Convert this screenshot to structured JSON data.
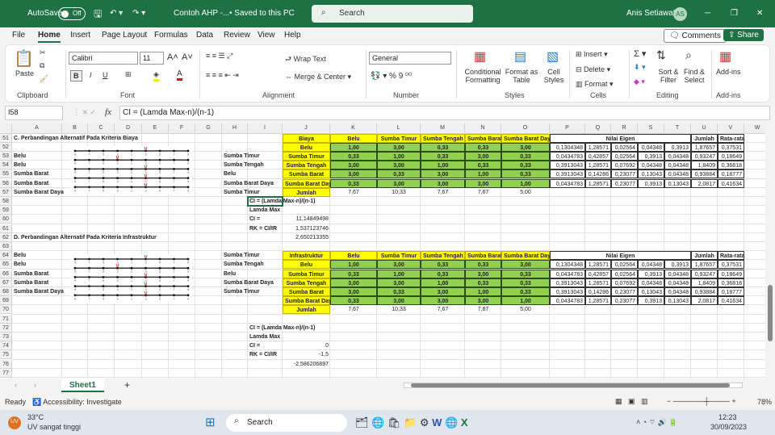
{
  "titlebar": {
    "autosave": "AutoSave",
    "toggle": "Off",
    "filename": "Contoh AHP -...",
    "saved": "• Saved to this PC",
    "search": "Search",
    "user": "Anis Setiawati",
    "initials": "AS"
  },
  "menu": [
    "File",
    "Home",
    "Insert",
    "Page Layout",
    "Formulas",
    "Data",
    "Review",
    "View",
    "Help"
  ],
  "comments": "Comments",
  "share": "Share",
  "ribbon": {
    "paste": "Paste",
    "font": "Calibri",
    "size": "11",
    "wrap": "Wrap Text",
    "merge": "Merge & Center",
    "numfmt": "General",
    "cond": "Conditional Formatting",
    "fmt_table": "Format as Table",
    "cell_styles": "Cell Styles",
    "insert": "Insert",
    "delete": "Delete",
    "format": "Format",
    "sort": "Sort & Filter",
    "find": "Find & Select",
    "addins": "Add-ins",
    "groups": [
      "Clipboard",
      "Font",
      "Alignment",
      "Number",
      "Styles",
      "Cells",
      "Editing",
      "Add-ins"
    ]
  },
  "formula_bar": {
    "namebox": "I58",
    "fx": "fx",
    "formula": "CI = (Lamda Max-n)/(n-1)"
  },
  "columns": [
    "A",
    "B",
    "C",
    "D",
    "E",
    "F",
    "G",
    "H",
    "I",
    "J",
    "K",
    "L",
    "M",
    "N",
    "O",
    "P",
    "Q",
    "R",
    "S",
    "T",
    "U",
    "V",
    "W"
  ],
  "rows": [
    51,
    52,
    53,
    54,
    55,
    56,
    57,
    58,
    59,
    60,
    61,
    62,
    63,
    64,
    65,
    66,
    67,
    68,
    69,
    70,
    71,
    72,
    73,
    74,
    75,
    76,
    77
  ],
  "selected_cell": "I58",
  "cells": [
    [
      "A51",
      "C. Perbandingan Alternatif Pada Kriteria Biaya",
      "b"
    ],
    [
      "J51",
      "Biaya",
      "y"
    ],
    [
      "K51",
      "Belu",
      "y"
    ],
    [
      "L51",
      "Sumba Timur",
      "y"
    ],
    [
      "M51",
      "Sumba Tengah",
      "y"
    ],
    [
      "N51",
      "Sumba Barat",
      "y"
    ],
    [
      "O51",
      "Sumba Barat Daya",
      "y"
    ],
    [
      "P51",
      "Nilai Eigen",
      "eh",
      5
    ],
    [
      "U51",
      "Jumlah",
      "eh"
    ],
    [
      "V51",
      "Rata-rata",
      "eh"
    ],
    [
      "J52",
      "Belu",
      "y"
    ],
    [
      "K52",
      "1,00",
      "g"
    ],
    [
      "L52",
      "3,00",
      "g"
    ],
    [
      "M52",
      "0,33",
      "g"
    ],
    [
      "N52",
      "0,33",
      "g"
    ],
    [
      "O52",
      "3,00",
      "g"
    ],
    [
      "P52",
      "0,1304348",
      "e"
    ],
    [
      "Q52",
      "1,28571",
      "e"
    ],
    [
      "R52",
      "0,02564",
      "e"
    ],
    [
      "S52",
      "0,04348",
      "e"
    ],
    [
      "T52",
      "0,3913",
      "e"
    ],
    [
      "U52",
      "1,87657",
      "e"
    ],
    [
      "V52",
      "0,37531",
      "e"
    ],
    [
      "A53",
      "Belu",
      "b"
    ],
    [
      "H53",
      "Sumba Timur",
      "b"
    ],
    [
      "J53",
      "Sumba Timur",
      "y"
    ],
    [
      "K53",
      "0,33",
      "g"
    ],
    [
      "L53",
      "1,00",
      "g"
    ],
    [
      "M53",
      "0,33",
      "g"
    ],
    [
      "N53",
      "3,00",
      "g"
    ],
    [
      "O53",
      "0,33",
      "g"
    ],
    [
      "P53",
      "0,0434783",
      "e"
    ],
    [
      "Q53",
      "0,42857",
      "e"
    ],
    [
      "R53",
      "0,02564",
      "e"
    ],
    [
      "S53",
      "0,3913",
      "e"
    ],
    [
      "T53",
      "0,04348",
      "e"
    ],
    [
      "U53",
      "0,93247",
      "e"
    ],
    [
      "V53",
      "0,18649",
      "e"
    ],
    [
      "A54",
      "Belu",
      "b"
    ],
    [
      "H54",
      "Sumba Tengah",
      "b"
    ],
    [
      "J54",
      "Sumba Tengah",
      "y"
    ],
    [
      "K54",
      "3,00",
      "g"
    ],
    [
      "L54",
      "3,00",
      "g"
    ],
    [
      "M54",
      "1,00",
      "g"
    ],
    [
      "N54",
      "0,33",
      "g"
    ],
    [
      "O54",
      "0,33",
      "g"
    ],
    [
      "P54",
      "0,3913043",
      "e"
    ],
    [
      "Q54",
      "1,28571",
      "e"
    ],
    [
      "R54",
      "0,07692",
      "e"
    ],
    [
      "S54",
      "0,04348",
      "e"
    ],
    [
      "T54",
      "0,04348",
      "e"
    ],
    [
      "U54",
      "1,8409",
      "e"
    ],
    [
      "V54",
      "0,36818",
      "e"
    ],
    [
      "A55",
      "Sumba Barat",
      "b"
    ],
    [
      "H55",
      "Belu",
      "b"
    ],
    [
      "J55",
      "Sumba Barat",
      "y"
    ],
    [
      "K55",
      "3,00",
      "g"
    ],
    [
      "L55",
      "0,33",
      "g"
    ],
    [
      "M55",
      "3,00",
      "g"
    ],
    [
      "N55",
      "1,00",
      "g"
    ],
    [
      "O55",
      "0,33",
      "g"
    ],
    [
      "P55",
      "0,3913043",
      "e"
    ],
    [
      "Q55",
      "0,14286",
      "e"
    ],
    [
      "R55",
      "0,23077",
      "e"
    ],
    [
      "S55",
      "0,13043",
      "e"
    ],
    [
      "T55",
      "0,04348",
      "e"
    ],
    [
      "U55",
      "0,93884",
      "e"
    ],
    [
      "V55",
      "0,18777",
      "e"
    ],
    [
      "A56",
      "Sumba Barat",
      "b"
    ],
    [
      "H56",
      "Sumba Barat Daya",
      "b"
    ],
    [
      "J56",
      "Sumba Barat Daya",
      "y"
    ],
    [
      "K56",
      "0,33",
      "g"
    ],
    [
      "L56",
      "3,00",
      "g"
    ],
    [
      "M56",
      "3,00",
      "g"
    ],
    [
      "N56",
      "3,00",
      "g"
    ],
    [
      "O56",
      "1,00",
      "g"
    ],
    [
      "P56",
      "0,0434783",
      "e"
    ],
    [
      "Q56",
      "1,28571",
      "e"
    ],
    [
      "R56",
      "0,23077",
      "e"
    ],
    [
      "S56",
      "0,3913",
      "e"
    ],
    [
      "T56",
      "0,13043",
      "e"
    ],
    [
      "U56",
      "2,0817",
      "e"
    ],
    [
      "V56",
      "0,41634",
      "e"
    ],
    [
      "A57",
      "Sumba Barat Daya",
      "b"
    ],
    [
      "H57",
      "Sumba Timur",
      "b"
    ],
    [
      "J57",
      "Jumlah",
      "y"
    ],
    [
      "K57",
      "7,67",
      "c"
    ],
    [
      "L57",
      "10,33",
      "c"
    ],
    [
      "M57",
      "7,67",
      "c"
    ],
    [
      "N57",
      "7,67",
      "c"
    ],
    [
      "O57",
      "5,00",
      "c"
    ],
    [
      "I58",
      "CI = (Lamda Max-n)/(n-1)",
      "b"
    ],
    [
      "I59",
      "Lamda Max",
      "b"
    ],
    [
      "I60",
      "CI =",
      "b"
    ],
    [
      "J60",
      "11,14849498",
      "n"
    ],
    [
      "I61",
      "RK = CI/IR",
      "b"
    ],
    [
      "J61",
      "1,537123746",
      "n"
    ],
    [
      "J62",
      "2,650213355",
      "n"
    ],
    [
      "A62",
      "D. Perbandingan Alternatif Pada Kriteria Infrastruktur",
      "b"
    ],
    [
      "A64",
      "Belu",
      "b"
    ],
    [
      "H64",
      "Sumba Timur",
      "b"
    ],
    [
      "J64",
      "Infrastruktur",
      "y"
    ],
    [
      "K64",
      "Belu",
      "y"
    ],
    [
      "L64",
      "Sumba Timur",
      "y"
    ],
    [
      "M64",
      "Sumba Tengah",
      "y"
    ],
    [
      "N64",
      "Sumba Barat",
      "y"
    ],
    [
      "O64",
      "Sumba Barat Daya",
      "y"
    ],
    [
      "P64",
      "Nilai Eigen",
      "eh",
      5
    ],
    [
      "U64",
      "Jumlah",
      "eh"
    ],
    [
      "V64",
      "Rata-rata",
      "eh"
    ],
    [
      "A65",
      "Belu",
      "b"
    ],
    [
      "H65",
      "Sumba Tengah",
      "b"
    ],
    [
      "J65",
      "Belu",
      "y"
    ],
    [
      "K65",
      "1,00",
      "g"
    ],
    [
      "L65",
      "3,00",
      "g"
    ],
    [
      "M65",
      "0,33",
      "g"
    ],
    [
      "N65",
      "0,33",
      "g"
    ],
    [
      "O65",
      "3,00",
      "g"
    ],
    [
      "P65",
      "0,1304348",
      "e"
    ],
    [
      "Q65",
      "1,28571",
      "e"
    ],
    [
      "R65",
      "0,02564",
      "e"
    ],
    [
      "S65",
      "0,04348",
      "e"
    ],
    [
      "T65",
      "0,3913",
      "e"
    ],
    [
      "U65",
      "1,87657",
      "e"
    ],
    [
      "V65",
      "0,37531",
      "e"
    ],
    [
      "A66",
      "Sumba Barat",
      "b"
    ],
    [
      "H66",
      "Belu",
      "b"
    ],
    [
      "J66",
      "Sumba Timur",
      "y"
    ],
    [
      "K66",
      "0,33",
      "g"
    ],
    [
      "L66",
      "1,00",
      "g"
    ],
    [
      "M66",
      "0,33",
      "g"
    ],
    [
      "N66",
      "3,00",
      "g"
    ],
    [
      "O66",
      "0,33",
      "g"
    ],
    [
      "P66",
      "0,0434783",
      "e"
    ],
    [
      "Q66",
      "0,42857",
      "e"
    ],
    [
      "R66",
      "0,02564",
      "e"
    ],
    [
      "S66",
      "0,3913",
      "e"
    ],
    [
      "T66",
      "0,04348",
      "e"
    ],
    [
      "U66",
      "0,93247",
      "e"
    ],
    [
      "V66",
      "0,18649",
      "e"
    ],
    [
      "A67",
      "Sumba Barat",
      "b"
    ],
    [
      "H67",
      "Sumba Barat Daya",
      "b"
    ],
    [
      "J67",
      "Sumba Tengah",
      "y"
    ],
    [
      "K67",
      "3,00",
      "g"
    ],
    [
      "L67",
      "3,00",
      "g"
    ],
    [
      "M67",
      "1,00",
      "g"
    ],
    [
      "N67",
      "0,33",
      "g"
    ],
    [
      "O67",
      "0,33",
      "g"
    ],
    [
      "P67",
      "0,3913043",
      "e"
    ],
    [
      "Q67",
      "1,28571",
      "e"
    ],
    [
      "R67",
      "0,07692",
      "e"
    ],
    [
      "S67",
      "0,04348",
      "e"
    ],
    [
      "T67",
      "0,04348",
      "e"
    ],
    [
      "U67",
      "1,8409",
      "e"
    ],
    [
      "V67",
      "0,36818",
      "e"
    ],
    [
      "A68",
      "Sumba Barat Daya",
      "b"
    ],
    [
      "H68",
      "Sumba Timur",
      "b"
    ],
    [
      "J68",
      "Sumba Barat",
      "y"
    ],
    [
      "K68",
      "3,00",
      "g"
    ],
    [
      "L68",
      "0,33",
      "g"
    ],
    [
      "M68",
      "3,00",
      "g"
    ],
    [
      "N68",
      "1,00",
      "g"
    ],
    [
      "O68",
      "0,33",
      "g"
    ],
    [
      "P68",
      "0,3913043",
      "e"
    ],
    [
      "Q68",
      "0,14286",
      "e"
    ],
    [
      "R68",
      "0,23077",
      "e"
    ],
    [
      "S68",
      "0,13043",
      "e"
    ],
    [
      "T68",
      "0,04348",
      "e"
    ],
    [
      "U68",
      "0,93884",
      "e"
    ],
    [
      "V68",
      "0,18777",
      "e"
    ],
    [
      "J69",
      "Sumba Barat Daya",
      "y"
    ],
    [
      "K69",
      "0,33",
      "g"
    ],
    [
      "L69",
      "3,00",
      "g"
    ],
    [
      "M69",
      "3,00",
      "g"
    ],
    [
      "N69",
      "3,00",
      "g"
    ],
    [
      "O69",
      "1,00",
      "g"
    ],
    [
      "P69",
      "0,0434783",
      "e"
    ],
    [
      "Q69",
      "1,28571",
      "e"
    ],
    [
      "R69",
      "0,23077",
      "e"
    ],
    [
      "S69",
      "0,3913",
      "e"
    ],
    [
      "T69",
      "0,13043",
      "e"
    ],
    [
      "U69",
      "2,0817",
      "e"
    ],
    [
      "V69",
      "0,41634",
      "e"
    ],
    [
      "J70",
      "Jumlah",
      "y"
    ],
    [
      "K70",
      "7,67",
      "c"
    ],
    [
      "L70",
      "10,33",
      "c"
    ],
    [
      "M70",
      "7,67",
      "c"
    ],
    [
      "N70",
      "7,67",
      "c"
    ],
    [
      "O70",
      "5,00",
      "c"
    ],
    [
      "I72",
      "CI = (Lamda Max-n)/(n-1)",
      "b"
    ],
    [
      "I73",
      "Lamda Max",
      "b"
    ],
    [
      "I74",
      "CI =",
      "b"
    ],
    [
      "J74",
      "0",
      "n"
    ],
    [
      "I75",
      "RK = CI/IR",
      "b"
    ],
    [
      "J75",
      "-1,5",
      "n"
    ],
    [
      "J76",
      "-2,586206897",
      "n"
    ]
  ],
  "scales": {
    "labels": [
      "9",
      "7",
      "5",
      "3",
      "1",
      "3",
      "5",
      "7",
      "9"
    ],
    "marker": "V",
    "biaya_marks": [
      5,
      3,
      5,
      5,
      5
    ],
    "infra_marks": [
      5,
      3,
      5,
      5,
      5
    ]
  },
  "sheet_tab": "Sheet1",
  "status": {
    "ready": "Ready",
    "accessibility": "Accessibility: Investigate",
    "zoom": "78%"
  },
  "taskbar": {
    "temp": "33°C",
    "weather": "UV sangat tinggi",
    "search": "Search",
    "time": "12:23",
    "date": "30/09/2023"
  }
}
